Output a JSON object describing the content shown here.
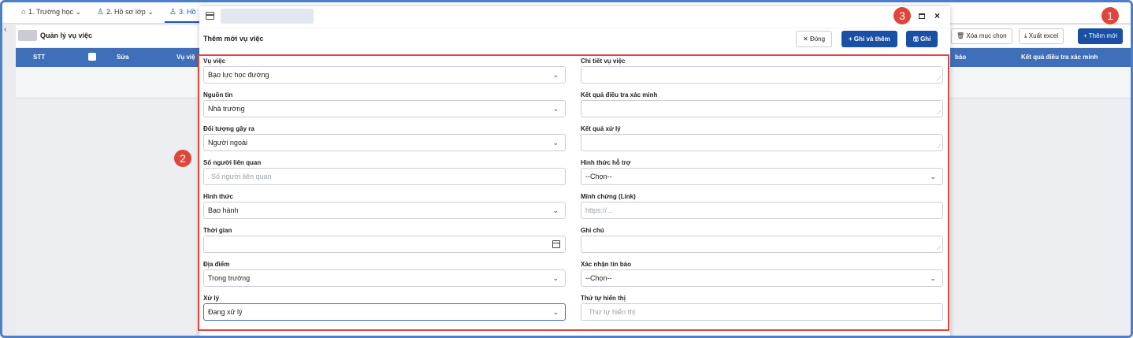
{
  "tabs": [
    {
      "label": "1. Trường học",
      "icon": "school-icon"
    },
    {
      "label": "2. Hồ sơ lớp",
      "icon": "person-icon"
    },
    {
      "label": "3. Hồ",
      "icon": "people-icon"
    }
  ],
  "page": {
    "title": "Quản lý vụ việc",
    "buttons": {
      "delete_selected": "Xóa mục chọn",
      "export_excel": "Xuất excel",
      "add_new": "Thêm mới"
    }
  },
  "grid": {
    "columns": [
      "STT",
      "Sửa",
      "Vụ việ",
      "báo",
      "Kết quả điều tra xác minh"
    ]
  },
  "modal": {
    "subtitle": "Thêm mới vụ việc",
    "buttons": {
      "close": "Đóng",
      "save_and_add": "Ghi và thêm",
      "save": "Ghi"
    },
    "left_fields": [
      {
        "label": "Vụ việc",
        "value": "Bạo lực học đường",
        "type": "select"
      },
      {
        "label": "Nguồn tin",
        "value": "Nhà trường",
        "type": "select"
      },
      {
        "label": "Đối tượng gây ra",
        "value": "Người ngoài",
        "type": "select"
      },
      {
        "label": "Số người liên quan",
        "placeholder": "Số người liên quan",
        "type": "input"
      },
      {
        "label": "Hình thức",
        "value": "Bạo hành",
        "type": "select"
      },
      {
        "label": "Thời gian",
        "value": "",
        "type": "date"
      },
      {
        "label": "Địa điểm",
        "value": "Trong trường",
        "type": "select"
      },
      {
        "label": "Xử lý",
        "value": "Đang xử lý",
        "type": "select"
      }
    ],
    "right_fields": [
      {
        "label": "Chi tiết vụ việc",
        "value": "",
        "type": "textarea"
      },
      {
        "label": "Kết quả điều tra xác minh",
        "value": "",
        "type": "textarea"
      },
      {
        "label": "Kết quả xử lý",
        "value": "",
        "type": "textarea"
      },
      {
        "label": "Hình thức hỗ trợ",
        "value": "--Chọn--",
        "type": "select"
      },
      {
        "label": "Minh chứng (Link)",
        "placeholder": "https://...",
        "type": "input"
      },
      {
        "label": "Ghi chú",
        "value": "",
        "type": "textarea"
      },
      {
        "label": "Xác nhận tin báo",
        "value": "--Chọn--",
        "type": "select"
      },
      {
        "label": "Thứ tự hiển thị",
        "placeholder": "Thứ tự hiển thị",
        "type": "input"
      }
    ]
  },
  "badges": [
    "1",
    "2",
    "3"
  ],
  "colors": {
    "primary": "#1a4fa6",
    "header": "#3f6fb8",
    "highlight": "#e0453a"
  }
}
